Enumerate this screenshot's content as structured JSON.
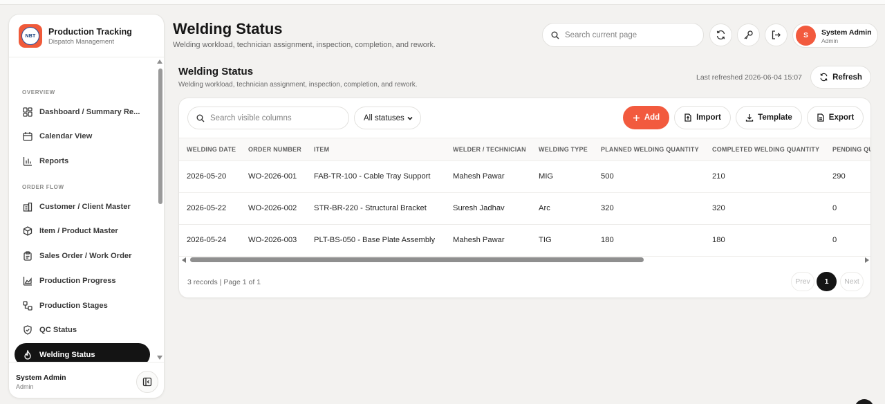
{
  "brand": {
    "title": "Production Tracking",
    "subtitle": "Dispatch Management",
    "logo_text": "NBT"
  },
  "nav": {
    "sections": [
      {
        "label": "OVERVIEW"
      },
      {
        "label": "ORDER FLOW"
      }
    ],
    "items": [
      {
        "label": "Dashboard / Summary Re...",
        "icon": "dashboard-icon"
      },
      {
        "label": "Calendar View",
        "icon": "calendar-icon"
      },
      {
        "label": "Reports",
        "icon": "bar-chart-icon"
      },
      {
        "label": "Customer / Client Master",
        "icon": "building-icon"
      },
      {
        "label": "Item / Product Master",
        "icon": "box-icon"
      },
      {
        "label": "Sales Order / Work Order",
        "icon": "clipboard-icon"
      },
      {
        "label": "Production Progress",
        "icon": "area-chart-icon"
      },
      {
        "label": "Production Stages",
        "icon": "workflow-icon"
      },
      {
        "label": "QC Status",
        "icon": "shield-icon"
      },
      {
        "label": "Welding Status",
        "icon": "flame-icon",
        "active": true
      }
    ]
  },
  "sidebar_footer": {
    "name": "System Admin",
    "role": "Admin"
  },
  "header": {
    "title": "Welding Status",
    "subtitle": "Welding workload, technician assignment, inspection, completion, and rework.",
    "search_placeholder": "Search current page",
    "user": {
      "name": "System Admin",
      "role": "Admin",
      "initial": "S"
    }
  },
  "section": {
    "title": "Welding Status",
    "subtitle": "Welding workload, technician assignment, inspection, completion, and rework.",
    "last_refreshed": "Last refreshed 2026-06-04 15:07",
    "refresh_label": "Refresh"
  },
  "toolbar": {
    "search_placeholder": "Search visible columns",
    "status_filter": "All statuses",
    "add_label": "Add",
    "import_label": "Import",
    "template_label": "Template",
    "export_label": "Export"
  },
  "table": {
    "columns": [
      "WELDING DATE",
      "ORDER NUMBER",
      "ITEM",
      "WELDER / TECHNICIAN",
      "WELDING TYPE",
      "PLANNED WELDING QUANTITY",
      "COMPLETED WELDING QUANTITY",
      "PENDING QU"
    ],
    "rows": [
      [
        "2026-05-20",
        "WO-2026-001",
        "FAB-TR-100 - Cable Tray Support",
        "Mahesh Pawar",
        "MIG",
        "500",
        "210",
        "290"
      ],
      [
        "2026-05-22",
        "WO-2026-002",
        "STR-BR-220 - Structural Bracket",
        "Suresh Jadhav",
        "Arc",
        "320",
        "320",
        "0"
      ],
      [
        "2026-05-24",
        "WO-2026-003",
        "PLT-BS-050 - Base Plate Assembly",
        "Mahesh Pawar",
        "TIG",
        "180",
        "180",
        "0"
      ]
    ]
  },
  "pagination": {
    "summary": "3 records | Page 1 of 1",
    "prev": "Prev",
    "current": "1",
    "next": "Next"
  },
  "colors": {
    "accent": "#f25a3e",
    "dark": "#151515",
    "background": "#f3f2f0"
  }
}
